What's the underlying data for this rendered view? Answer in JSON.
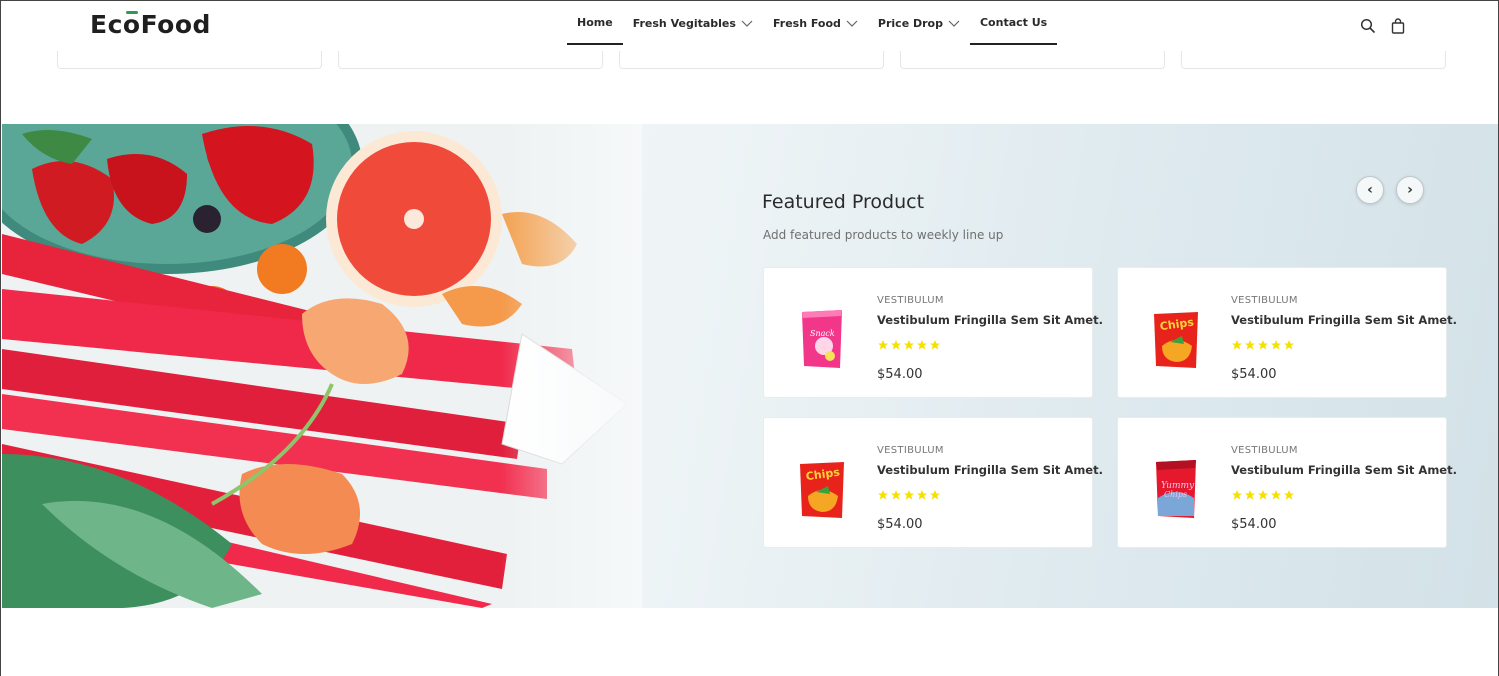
{
  "brand": {
    "logo_text_1": "Ec",
    "logo_text_o": "o",
    "logo_text_2": "Food",
    "accent_color": "#2e9c4e"
  },
  "nav": {
    "items": [
      {
        "label": "Home",
        "active": true,
        "dropdown": false
      },
      {
        "label": "Fresh Vegitables",
        "active": false,
        "dropdown": true
      },
      {
        "label": "Fresh Food",
        "active": false,
        "dropdown": true
      },
      {
        "label": "Price Drop",
        "active": false,
        "dropdown": true
      },
      {
        "label": "Contact Us",
        "active": true,
        "dropdown": false
      }
    ],
    "icons": [
      "search-icon",
      "shopping-bag-icon"
    ]
  },
  "featured": {
    "title": "Featured Product",
    "subtitle": "Add featured products to weekly line up",
    "prev_icon": "‹",
    "next_icon": "›",
    "products": [
      {
        "category": "VESTIBULUM",
        "name": "Vestibulum Fringilla Sem Sit Amet.",
        "rating": 5,
        "price": "$54.00",
        "icon": "pink-chips-bag"
      },
      {
        "category": "VESTIBULUM",
        "name": "Vestibulum Fringilla Sem Sit Amet.",
        "rating": 5,
        "price": "$54.00",
        "icon": "red-chips-bag"
      },
      {
        "category": "VESTIBULUM",
        "name": "Vestibulum Fringilla Sem Sit Amet.",
        "rating": 5,
        "price": "$54.00",
        "icon": "red-chips-bag"
      },
      {
        "category": "VESTIBULUM",
        "name": "Vestibulum Fringilla Sem Sit Amet.",
        "rating": 5,
        "price": "$54.00",
        "icon": "yummy-chips-bag"
      }
    ],
    "star_color": "#f5e100"
  }
}
